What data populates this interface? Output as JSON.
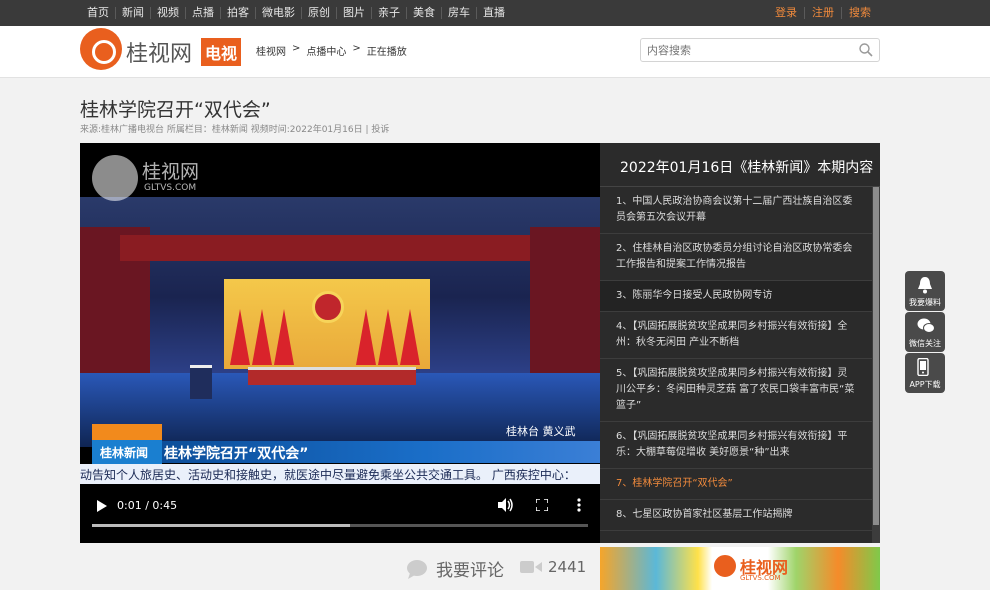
{
  "nav": {
    "links": [
      "首页",
      "新闻",
      "视频",
      "点播",
      "拍客",
      "微电影",
      "原创",
      "图片",
      "亲子",
      "美食",
      "房车",
      "直播"
    ],
    "right": [
      "登录",
      "注册",
      "搜索"
    ]
  },
  "header": {
    "logo_name": "桂视网",
    "logo_tag": "电视",
    "breadcrumb": [
      "桂视网",
      ">",
      "点播中心",
      ">",
      "正在播放"
    ],
    "search_placeholder": "内容搜索"
  },
  "page": {
    "title": "桂林学院召开“双代会”",
    "meta": "来源:桂林广播电视台 所属栏目：桂林新闻 视频时间:2022年01月16日 | 投诉"
  },
  "video": {
    "watermark": "桂视网",
    "watermark_url": "GLTVS.COM",
    "caption": "桂林台  黄义武",
    "lower_third_tag": "桂林新闻",
    "lower_third_title": "桂林学院召开“双代会”",
    "ticker": "动告知个人旅居史、活动史和接触史，就医途中尽量避免乘坐公共交通工具。   广西疾控中心：",
    "time": "0:01 / 0:45",
    "progress": 0.52
  },
  "playlist": {
    "header": "2022年01月16日《桂林新闻》本期内容",
    "items": [
      "1、中国人民政治协商会议第十二届广西壮族自治区委员会第五次会议开幕",
      "2、住桂林自治区政协委员分组讨论自治区政协常委会工作报告和提案工作情况报告",
      "3、陈丽华今日接受人民政协网专访",
      "4、【巩固拓展脱贫攻坚成果同乡村振兴有效衔接】全州：秋冬无闲田 产业不断档",
      "5、【巩固拓展脱贫攻坚成果同乡村振兴有效衔接】灵川公平乡：冬闲田种灵芝菇 富了农民口袋丰富市民“菜篮子”",
      "6、【巩固拓展脱贫攻坚成果同乡村振兴有效衔接】平乐：大棚草莓促增收 美好愿景“种”出来",
      "7、桂林学院召开“双代会”",
      "8、七星区政协首家社区基层工作站揭牌"
    ],
    "selected_index": 2,
    "current_index": 6
  },
  "comment": {
    "label": "我要评论",
    "views": "2441"
  },
  "ad": {
    "name": "桂视网",
    "url": "GLTVS.COM"
  },
  "side": {
    "items": [
      "我要爆料",
      "微信关注",
      "APP下载"
    ]
  },
  "colors": {
    "accent": "#f08a3c",
    "brand": "#e95f1e",
    "nav_bg": "#3a3a3a",
    "playlist_bg": "#2b2b2b"
  }
}
